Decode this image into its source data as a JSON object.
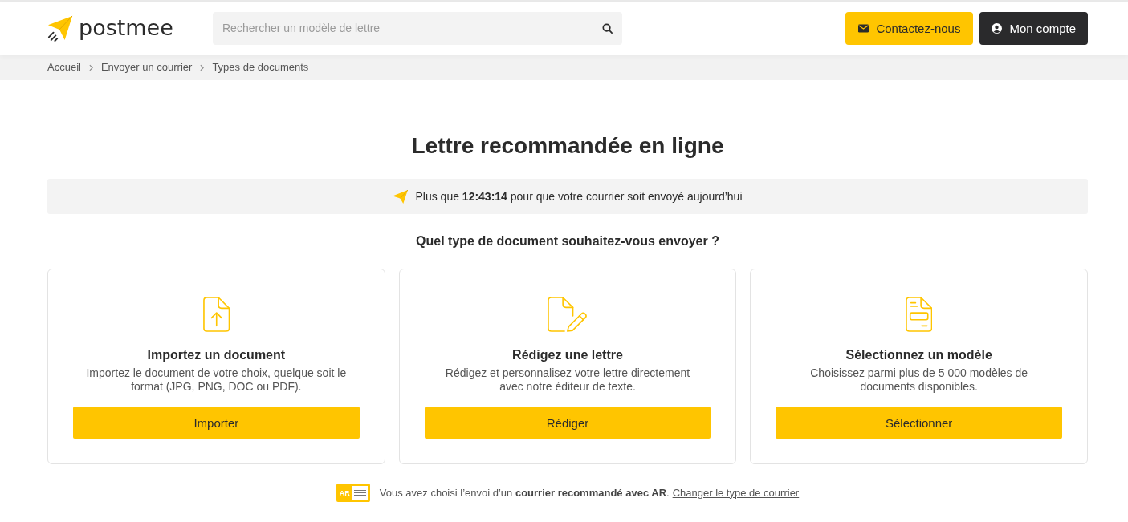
{
  "header": {
    "logo": "postmee",
    "search": {
      "placeholder": "Rechercher un modèle de lettre"
    },
    "buttons": [
      {
        "kind": "contact",
        "label": "Contactez-nous"
      },
      {
        "kind": "account",
        "label": "Mon compte"
      }
    ]
  },
  "breadcrumb": [
    "Accueil",
    "Envoyer un courrier",
    "Types de documents"
  ],
  "title": "Lettre recommandée en ligne",
  "countdown": "Plus que **12:43:14** pour que votre courrier soit envoyé aujourd’hui",
  "question": "Quel type de document souhaitez-vous envoyer ?",
  "options": [
    {
      "kind": "upload",
      "title": "Importez un document",
      "description": "Importez le document de votre choix, quelque soit le format (JPG, PNG, DOC ou PDF).",
      "button": "Importer"
    },
    {
      "kind": "write",
      "title": "Rédigez une lettre",
      "description": "Rédigez et personnalisez votre lettre directement avec notre éditeur de texte.",
      "button": "Rédiger"
    },
    {
      "kind": "template",
      "title": "Sélectionnez un modèle",
      "description": "Choisissez parmi plus de 5 000 modèles de documents disponibles.",
      "button": "Sélectionner"
    }
  ],
  "footer": {
    "badge": "AR",
    "text": "Vous avez choisi l’envoi d’un **courrier recommandé avec AR**.",
    "link": "Changer le type de courrier"
  }
}
